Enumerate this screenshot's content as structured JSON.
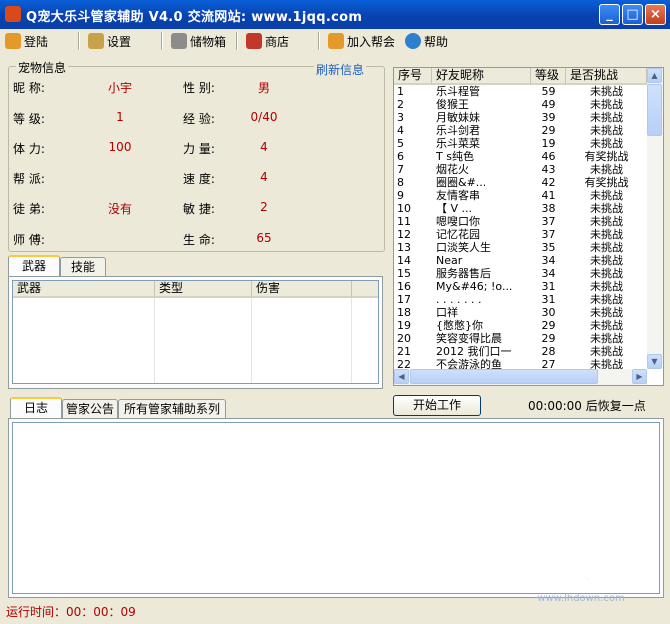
{
  "window": {
    "title": "Q宠大乐斗管家辅助  V4.0  交流网站: www.1jqq.com",
    "minimize_glyph": "_",
    "maximize_glyph": "□",
    "close_glyph": "×"
  },
  "toolbar": {
    "items": [
      {
        "label": "登陆",
        "icon": "house-icon"
      },
      {
        "label": "设置",
        "icon": "wrench-icon"
      },
      {
        "label": "储物箱",
        "icon": "box-icon"
      },
      {
        "label": "商店",
        "icon": "cart-icon"
      },
      {
        "label": "加入帮会",
        "icon": "house-icon"
      },
      {
        "label": "帮助",
        "icon": "globe-icon"
      }
    ]
  },
  "pet_info": {
    "group_title": "宠物信息",
    "refresh_label": "刷新信息",
    "nickname_label": "昵  称:",
    "nickname_value": "小宇",
    "gender_label": "性  别:",
    "gender_value": "男",
    "level_label": "等  级:",
    "level_value": "1",
    "exp_label": "经  验:",
    "exp_value": "0/40",
    "stamina_label": "体  力:",
    "stamina_value": "100",
    "power_label": "力  量:",
    "power_value": "4",
    "faction_label": "帮  派:",
    "faction_value": "",
    "speed_label": "速  度:",
    "speed_value": "4",
    "apprentice_label": "徒  弟:",
    "apprentice_value": "没有",
    "agility_label": "敏  捷:",
    "agility_value": "2",
    "master_label": "师  傅:",
    "master_value": "",
    "life_label": "生  命:",
    "life_value": "65"
  },
  "equip_tabs": {
    "weapon_tab": "武器",
    "skill_tab": "技能",
    "columns": [
      "武器",
      "类型",
      "伤害"
    ]
  },
  "friends": {
    "columns": [
      "序号",
      "好友昵称",
      "等级",
      "是否挑战"
    ],
    "rows": [
      [
        "1",
        "乐斗程管",
        "59",
        "未挑战"
      ],
      [
        "2",
        "俊猴王",
        "49",
        "未挑战"
      ],
      [
        "3",
        "月敏妹妹",
        "39",
        "未挑战"
      ],
      [
        "4",
        "乐斗剑君",
        "29",
        "未挑战"
      ],
      [
        "5",
        "乐斗菜菜",
        "19",
        "未挑战"
      ],
      [
        "6",
        "T s纯色",
        "46",
        "有奖挑战"
      ],
      [
        "7",
        "烟花火",
        "43",
        "未挑战"
      ],
      [
        "8",
        "    圈圈&#...",
        "42",
        "有奖挑战"
      ],
      [
        "9",
        "友情客串",
        "41",
        "未挑战"
      ],
      [
        "10",
        "【   V   ...",
        "38",
        "未挑战"
      ],
      [
        "11",
        "嗯嗖口你",
        "37",
        "未挑战"
      ],
      [
        "12",
        "记忆花园",
        "37",
        "未挑战"
      ],
      [
        "13",
        "口淡笑人生",
        "35",
        "未挑战"
      ],
      [
        "14",
        "Near",
        "34",
        "未挑战"
      ],
      [
        "15",
        "服务器售后",
        "34",
        "未挑战"
      ],
      [
        "16",
        "Мy&#46; !o...",
        "31",
        "未挑战"
      ],
      [
        "17",
        ". . . . . . .",
        "31",
        "未挑战"
      ],
      [
        "18",
        "   口祥",
        "30",
        "未挑战"
      ],
      [
        "19",
        "   {憋憋}你",
        "29",
        "未挑战"
      ],
      [
        "20",
        "笑容变得比晨",
        "29",
        "未挑战"
      ],
      [
        "21",
        "2012 我们口一",
        "28",
        "未挑战"
      ],
      [
        "22",
        "不会游泳的鱼",
        "27",
        "未挑战"
      ]
    ]
  },
  "log_tabs": {
    "log_tab": "日志",
    "notice_tab": "管家公告",
    "series_tab": "所有管家辅助系列"
  },
  "controls": {
    "start_button": "开始工作",
    "recover_text": "00:00:00 后恢复一点"
  },
  "status": {
    "runtime": "运行时间：00：00：09"
  },
  "watermark": {
    "brand": "领航下载站",
    "url": "www.lhdown.com"
  },
  "colors": {
    "value_red": "#b00000",
    "title_blue": "#0a5fd8",
    "refresh_blue": "#1f5fbf"
  }
}
